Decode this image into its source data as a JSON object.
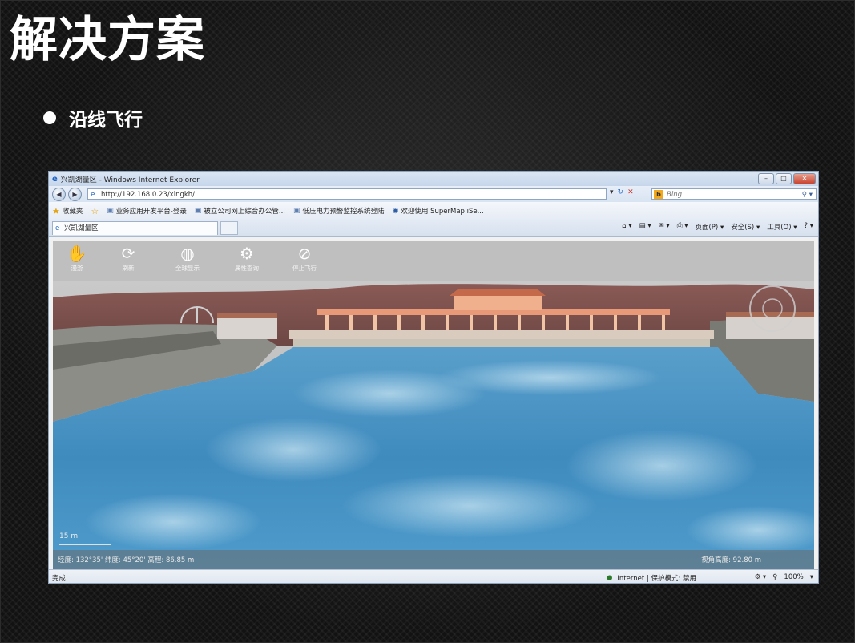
{
  "slide": {
    "title": "解决方案",
    "bullet": "沿线飞行"
  },
  "browser": {
    "window_title": "兴凯湖量区 - Windows Internet Explorer",
    "url": "http://192.168.0.23/xingkh/",
    "search_placeholder": "Bing",
    "favorites": {
      "label": "收藏夹",
      "items": [
        "业务应用开发平台-登录",
        "被立公司网上综合办公管...",
        "低压电力预警监控系统登陆",
        "欢迎使用 SuperMap iSe..."
      ]
    },
    "tab_title": "兴凯湖量区",
    "command_bar": {
      "page": "页面(P) ▾",
      "safety": "安全(S) ▾",
      "tools": "工具(O) ▾"
    },
    "status": {
      "left": "完成",
      "zone": "Internet | 保护模式: 禁用",
      "zoom": "100%"
    }
  },
  "app": {
    "toolbar": [
      {
        "icon": "hand-icon",
        "label": "漫游"
      },
      {
        "icon": "refresh-icon",
        "label": "刷新"
      },
      {
        "icon": "globe-icon",
        "label": "全球显示"
      },
      {
        "icon": "gear-icon",
        "label": "属性查询"
      },
      {
        "icon": "stop-flight-icon",
        "label": "停止飞行"
      }
    ],
    "scale_label": "15 m",
    "status_left": "经度: 132°35' 纬度: 45°20' 高程: 86.85 m",
    "status_right": "视角高度: 92.80 m"
  },
  "colors": {
    "water": "#4a93c4",
    "terrain": "#7a4e4a",
    "bridge": "#e89a78",
    "slide_bg": "#141414"
  }
}
